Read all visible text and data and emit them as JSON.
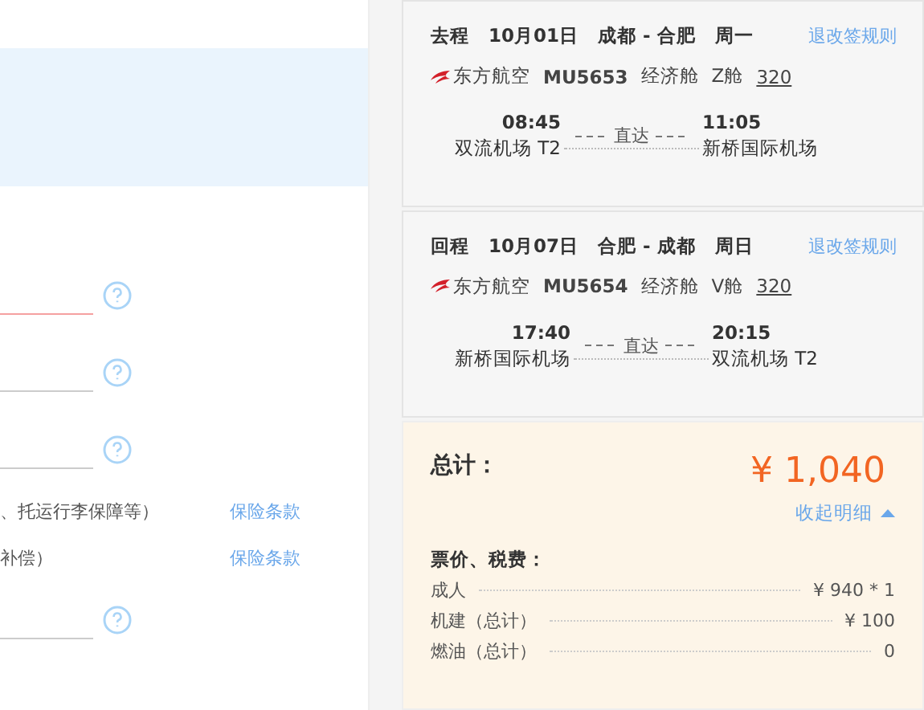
{
  "form": {
    "fields": [
      {
        "kind": "field",
        "error": true
      },
      {
        "kind": "field",
        "error": false
      },
      {
        "kind": "field",
        "error": false
      },
      {
        "kind": "insurance",
        "text": "、托运行李保障等）",
        "link": "保险条款"
      },
      {
        "kind": "insurance",
        "text": "补偿）",
        "link": "保险条款"
      },
      {
        "kind": "field",
        "error": false
      }
    ]
  },
  "flights": [
    {
      "direction": "去程",
      "date": "10月01日",
      "route": "成都 - 合肥",
      "weekday": "周一",
      "rules_link": "退改签规则",
      "airline": "东方航空",
      "flight_no": "MU5653",
      "cabin_class": "经济舱",
      "cabin": "Z舱",
      "aircraft": "320",
      "depart_time": "08:45",
      "depart_airport": "双流机场 T2",
      "stop": "直达",
      "arrive_time": "11:05",
      "arrive_airport": "新桥国际机场"
    },
    {
      "direction": "回程",
      "date": "10月07日",
      "route": "合肥 - 成都",
      "weekday": "周日",
      "rules_link": "退改签规则",
      "airline": "东方航空",
      "flight_no": "MU5654",
      "cabin_class": "经济舱",
      "cabin": "V舱",
      "aircraft": "320",
      "depart_time": "17:40",
      "depart_airport": "新桥国际机场",
      "stop": "直达",
      "arrive_time": "20:15",
      "arrive_airport": "双流机场 T2"
    }
  ],
  "total": {
    "label": "总计：",
    "amount": "¥ 1,040",
    "toggle": "收起明细",
    "expanded": true,
    "section": "票价、税费：",
    "items": [
      {
        "label": "成人",
        "value": "¥ 940 * 1"
      },
      {
        "label": "机建（总计）",
        "value": "¥ 100"
      },
      {
        "label": "燃油（总计）",
        "value": "0"
      }
    ]
  }
}
